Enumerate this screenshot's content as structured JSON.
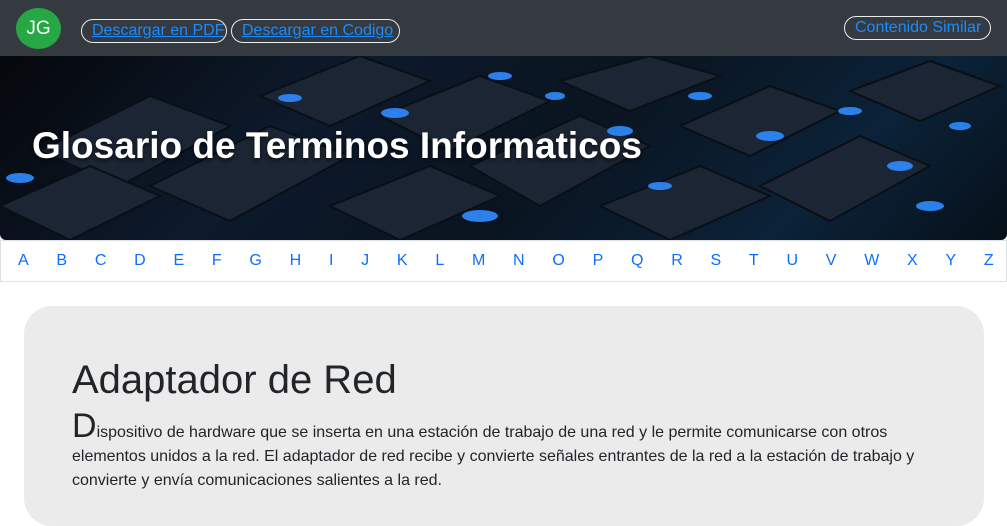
{
  "header": {
    "avatar_initials": "JG",
    "download_pdf_label": "Descargar en PDF",
    "download_code_label": "Descargar en Codigo",
    "similar_content_label": "Contenido Similar"
  },
  "hero": {
    "title": "Glosario de Terminos Informaticos"
  },
  "alphabet": [
    "A",
    "B",
    "C",
    "D",
    "E",
    "F",
    "G",
    "H",
    "I",
    "J",
    "K",
    "L",
    "M",
    "N",
    "O",
    "P",
    "Q",
    "R",
    "S",
    "T",
    "U",
    "V",
    "W",
    "X",
    "Y",
    "Z"
  ],
  "term": {
    "title": "Adaptador de Red",
    "first_letter": "D",
    "description_rest": "ispositivo de hardware que se inserta en una estación de trabajo de una red y le permite comunicarse con otros elementos unidos a la red. El adaptador de red recibe y convierte señales entrantes de la red a la estación de trabajo y convierte y envía comunicaciones salientes a la red."
  },
  "colors": {
    "topbar": "#343a40",
    "avatar": "#28a745",
    "link": "#0d6efd",
    "card": "#ebebeb"
  }
}
